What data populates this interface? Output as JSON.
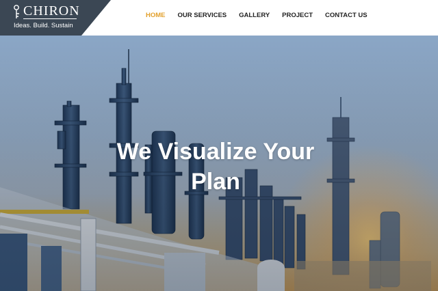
{
  "brand": {
    "name": "CHIRON",
    "tagline": "Ideas. Build. Sustain",
    "logo_icon": "key-icon"
  },
  "nav": {
    "items": [
      {
        "label": "HOME",
        "active": true
      },
      {
        "label": "OUR SERVICES",
        "active": false
      },
      {
        "label": "GALLERY",
        "active": false
      },
      {
        "label": "PROJECT",
        "active": false
      },
      {
        "label": "CONTACT US",
        "active": false
      }
    ]
  },
  "hero": {
    "title": "We Visualize Your Plan"
  },
  "colors": {
    "accent": "#e2a02c",
    "logo_bg": "#3b4754",
    "nav_text": "#222222"
  }
}
